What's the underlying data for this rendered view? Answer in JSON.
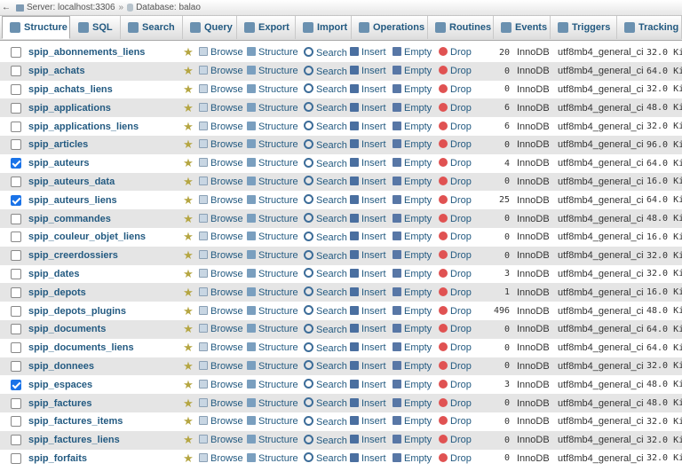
{
  "breadcrumb": {
    "server": "Server: localhost:3306",
    "database": "Database: balao"
  },
  "tabs": [
    {
      "label": "Structure",
      "icon": "structure-icon",
      "active": true
    },
    {
      "label": "SQL",
      "icon": "sql-icon"
    },
    {
      "label": "Search",
      "icon": "search-icon"
    },
    {
      "label": "Query",
      "icon": "query-icon"
    },
    {
      "label": "Export",
      "icon": "export-icon"
    },
    {
      "label": "Import",
      "icon": "import-icon"
    },
    {
      "label": "Operations",
      "icon": "wrench-icon"
    },
    {
      "label": "Routines",
      "icon": "routines-icon"
    },
    {
      "label": "Events",
      "icon": "clock-icon"
    },
    {
      "label": "Triggers",
      "icon": "triggers-icon"
    },
    {
      "label": "Tracking",
      "icon": "eye-icon"
    }
  ],
  "actions": {
    "browse": "Browse",
    "structure": "Structure",
    "search": "Search",
    "insert": "Insert",
    "empty": "Empty",
    "drop": "Drop"
  },
  "tables": [
    {
      "name": "spip_abonnements_liens",
      "checked": false,
      "rows": "20",
      "engine": "InnoDB",
      "collation": "utf8mb4_general_ci",
      "size": "32.0 KiB"
    },
    {
      "name": "spip_achats",
      "checked": false,
      "rows": "0",
      "engine": "InnoDB",
      "collation": "utf8mb4_general_ci",
      "size": "64.0 KiB"
    },
    {
      "name": "spip_achats_liens",
      "checked": false,
      "rows": "0",
      "engine": "InnoDB",
      "collation": "utf8mb4_general_ci",
      "size": "32.0 KiB"
    },
    {
      "name": "spip_applications",
      "checked": false,
      "rows": "6",
      "engine": "InnoDB",
      "collation": "utf8mb4_general_ci",
      "size": "48.0 KiB"
    },
    {
      "name": "spip_applications_liens",
      "checked": false,
      "rows": "6",
      "engine": "InnoDB",
      "collation": "utf8mb4_general_ci",
      "size": "32.0 KiB"
    },
    {
      "name": "spip_articles",
      "checked": false,
      "rows": "0",
      "engine": "InnoDB",
      "collation": "utf8mb4_general_ci",
      "size": "96.0 KiB"
    },
    {
      "name": "spip_auteurs",
      "checked": true,
      "rows": "4",
      "engine": "InnoDB",
      "collation": "utf8mb4_general_ci",
      "size": "64.0 KiB"
    },
    {
      "name": "spip_auteurs_data",
      "checked": false,
      "rows": "0",
      "engine": "InnoDB",
      "collation": "utf8mb4_general_ci",
      "size": "16.0 KiB"
    },
    {
      "name": "spip_auteurs_liens",
      "checked": true,
      "rows": "25",
      "engine": "InnoDB",
      "collation": "utf8mb4_general_ci",
      "size": "64.0 KiB"
    },
    {
      "name": "spip_commandes",
      "checked": false,
      "rows": "0",
      "engine": "InnoDB",
      "collation": "utf8mb4_general_ci",
      "size": "48.0 KiB"
    },
    {
      "name": "spip_couleur_objet_liens",
      "checked": false,
      "rows": "0",
      "engine": "InnoDB",
      "collation": "utf8mb4_general_ci",
      "size": "16.0 KiB"
    },
    {
      "name": "spip_creerdossiers",
      "checked": false,
      "rows": "0",
      "engine": "InnoDB",
      "collation": "utf8mb4_general_ci",
      "size": "32.0 KiB"
    },
    {
      "name": "spip_dates",
      "checked": false,
      "rows": "3",
      "engine": "InnoDB",
      "collation": "utf8mb4_general_ci",
      "size": "32.0 KiB"
    },
    {
      "name": "spip_depots",
      "checked": false,
      "rows": "1",
      "engine": "InnoDB",
      "collation": "utf8mb4_general_ci",
      "size": "16.0 KiB"
    },
    {
      "name": "spip_depots_plugins",
      "checked": false,
      "rows": "496",
      "engine": "InnoDB",
      "collation": "utf8mb4_general_ci",
      "size": "48.0 KiB"
    },
    {
      "name": "spip_documents",
      "checked": false,
      "rows": "0",
      "engine": "InnoDB",
      "collation": "utf8mb4_general_ci",
      "size": "64.0 KiB"
    },
    {
      "name": "spip_documents_liens",
      "checked": false,
      "rows": "0",
      "engine": "InnoDB",
      "collation": "utf8mb4_general_ci",
      "size": "64.0 KiB"
    },
    {
      "name": "spip_donnees",
      "checked": false,
      "rows": "0",
      "engine": "InnoDB",
      "collation": "utf8mb4_general_ci",
      "size": "32.0 KiB"
    },
    {
      "name": "spip_espaces",
      "checked": true,
      "rows": "3",
      "engine": "InnoDB",
      "collation": "utf8mb4_general_ci",
      "size": "48.0 KiB"
    },
    {
      "name": "spip_factures",
      "checked": false,
      "rows": "0",
      "engine": "InnoDB",
      "collation": "utf8mb4_general_ci",
      "size": "48.0 KiB"
    },
    {
      "name": "spip_factures_items",
      "checked": false,
      "rows": "0",
      "engine": "InnoDB",
      "collation": "utf8mb4_general_ci",
      "size": "32.0 KiB"
    },
    {
      "name": "spip_factures_liens",
      "checked": false,
      "rows": "0",
      "engine": "InnoDB",
      "collation": "utf8mb4_general_ci",
      "size": "32.0 KiB"
    },
    {
      "name": "spip_forfaits",
      "checked": false,
      "rows": "0",
      "engine": "InnoDB",
      "collation": "utf8mb4_general_ci",
      "size": "32.0 KiB"
    }
  ]
}
